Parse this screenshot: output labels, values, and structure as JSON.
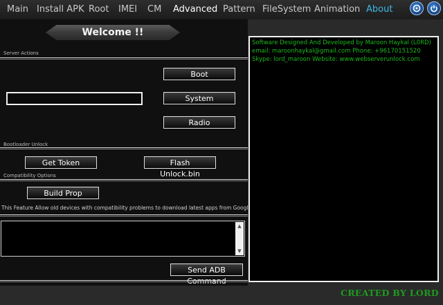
{
  "nav": {
    "tabs": [
      {
        "label": "Main"
      },
      {
        "label": "Install APK"
      },
      {
        "label": "Root"
      },
      {
        "label": "IMEI"
      },
      {
        "label": "CM"
      },
      {
        "label": "Advanced"
      },
      {
        "label": "Pattern"
      },
      {
        "label": "FileSystem"
      },
      {
        "label": "Animation"
      },
      {
        "label": "About"
      }
    ],
    "active_tab": "Advanced",
    "icons": [
      "info-icon",
      "power-icon"
    ]
  },
  "welcome": "Welcome !!",
  "server_actions": {
    "label": "Server Actions",
    "input_value": "",
    "buttons": {
      "boot": "Boot",
      "system": "System",
      "radio": "Radio"
    }
  },
  "bootloader": {
    "label": "Bootloader Unlock",
    "get_token": "Get Token",
    "flash_unlock": "Flash Unlock.bin"
  },
  "compatibility": {
    "label": "Compatibility Options",
    "build_prop": "Build Prop",
    "info": "This Feature Allow old devices with compatibility problems to download latest apps from Google Markets"
  },
  "adb": {
    "command_value": "",
    "send_button": "Send ADB Command"
  },
  "console": {
    "line1": "Software Designed And Developed by Maroon Haykal (L0RD)",
    "line2": "email: maroonhaykal@gmail.com Phone: +96170151520",
    "line3": "Skype: lord_maroon Website: www.webserverunlock.com"
  },
  "credit": "CREATED BY LORD",
  "colors": {
    "accent_blue": "#3fb8e8",
    "console_green": "#1db81d",
    "credit_green": "#1f9a1f"
  }
}
